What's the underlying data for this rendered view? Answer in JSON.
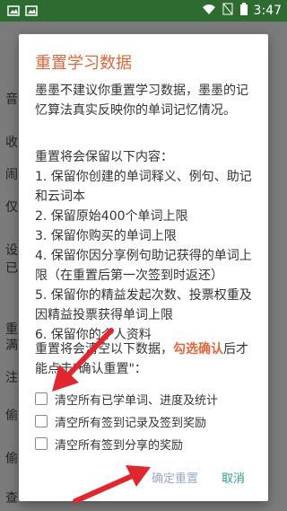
{
  "status_bar": {
    "time": "3:47"
  },
  "background": {
    "left_letters": [
      "音",
      "收",
      "闹",
      "仅",
      "设",
      "已",
      "重",
      "满",
      "注",
      "偷",
      "偷",
      "查"
    ]
  },
  "dialog": {
    "title": "重置学习数据",
    "intro": "墨墨不建议你重置学习数据，墨墨的记忆算法真实反映你的单词记忆情况。",
    "keep_header": "重置将会保留以下内容：",
    "keep_items": [
      "1. 保留你创建的单词释义、例句、助记和云词本",
      "2. 保留原始400个单词上限",
      "3. 保留你购买的单词上限",
      "4. 保留你因分享例句助记获得的单词上限（在重置后第一次签到时返还）",
      "5. 保留你的精益发起次数、投票权重及因精益投票获得单词上限",
      "6. 保留你的个人资料"
    ],
    "clear_text_a": "重置将会清空以下数据，",
    "clear_highlight": "勾选确认",
    "clear_text_b": "后才能点击\"确认重置\"：",
    "checkboxes": [
      "清空所有已学单词、进度及统计",
      "清空所有签到记录及签到奖励",
      "清空所有签到分享的奖励"
    ],
    "confirm_label": "确定重置",
    "cancel_label": "取消"
  },
  "colors": {
    "accent": "#e0673c",
    "status_bar": "#2d6b31",
    "arrow": "#e0262e"
  }
}
